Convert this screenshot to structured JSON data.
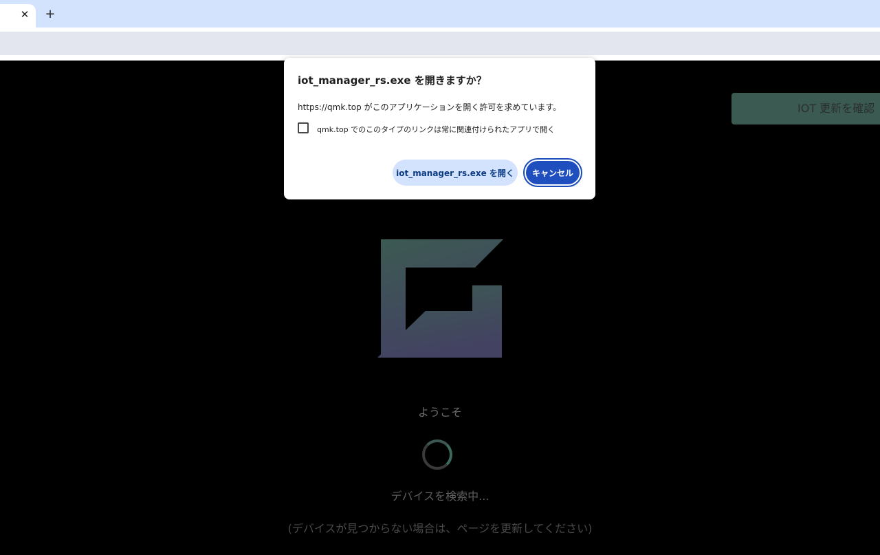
{
  "browser": {
    "tab_close_glyph": "✕",
    "new_tab_glyph": "+"
  },
  "dialog": {
    "title": "iot_manager_rs.exe を開きますか？",
    "message": "https://qmk.top がこのアプリケーションを開く許可を求めています。",
    "checkbox_label": "qmk.top でのこのタイプのリンクは常に関連付けられたアプリで開く",
    "checkbox_checked": false,
    "open_button": "iot_manager_rs.exe を開く",
    "cancel_button": "キャンセル"
  },
  "page": {
    "iot_update_button": "IOT 更新を確認",
    "welcome": "ようこそ",
    "searching": "デバイスを検索中...",
    "hint": "(デバイスが見つからない場合は、ページを更新してください)",
    "accent_color": "#3b5a51"
  }
}
